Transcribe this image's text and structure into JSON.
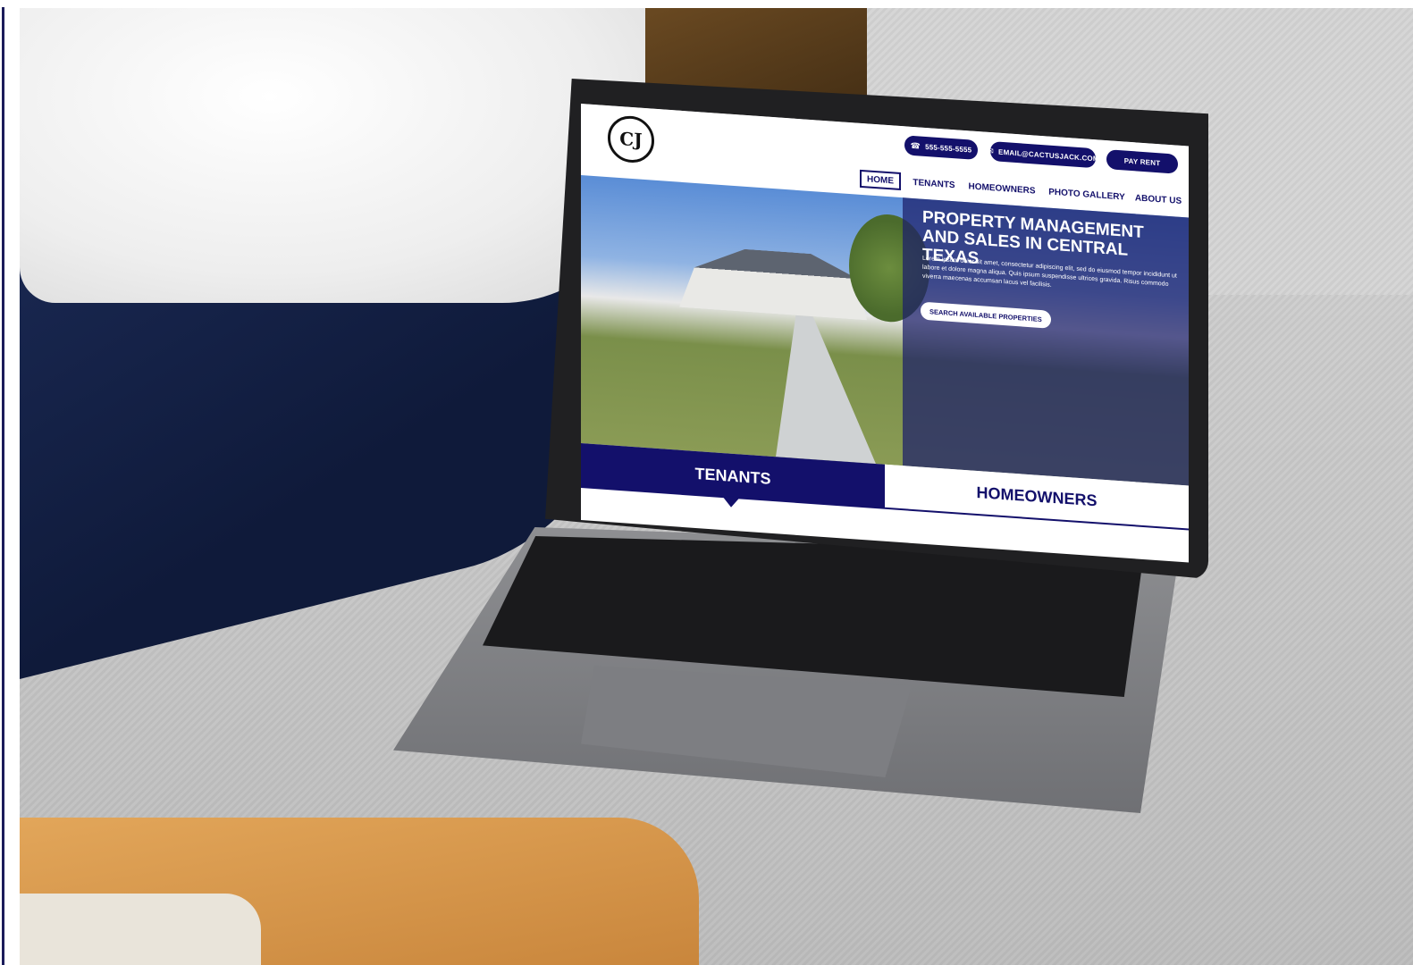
{
  "site": {
    "logo_text": "CJ",
    "contact": {
      "phone": "555-555-5555",
      "email": "EMAIL@CACTUSJACK.COM",
      "pay_rent": "PAY RENT"
    },
    "nav": [
      {
        "label": "HOME",
        "active": true
      },
      {
        "label": "TENANTS",
        "active": false
      },
      {
        "label": "HOMEOWNERS",
        "active": false
      },
      {
        "label": "PHOTO GALLERY",
        "active": false
      },
      {
        "label": "ABOUT US",
        "active": false
      }
    ],
    "hero": {
      "title": "PROPERTY MANAGEMENT AND SALES IN CENTRAL TEXAS",
      "body": "Lorem ipsum dolor sit amet, consectetur adipiscing elit, sed do eiusmod tempor incididunt ut labore et dolore magna aliqua. Quis ipsum suspendisse ultrices gravida. Risus commodo viverra maecenas accumsan lacus vel facilisis.",
      "button": "SEARCH AVAILABLE PROPERTIES"
    },
    "tabs": {
      "tenants": "TENANTS",
      "homeowners": "HOMEOWNERS"
    }
  },
  "icons": {
    "phone": "phone-icon",
    "email": "mail-icon"
  },
  "colors": {
    "brand_navy": "#13106b",
    "white": "#ffffff"
  }
}
